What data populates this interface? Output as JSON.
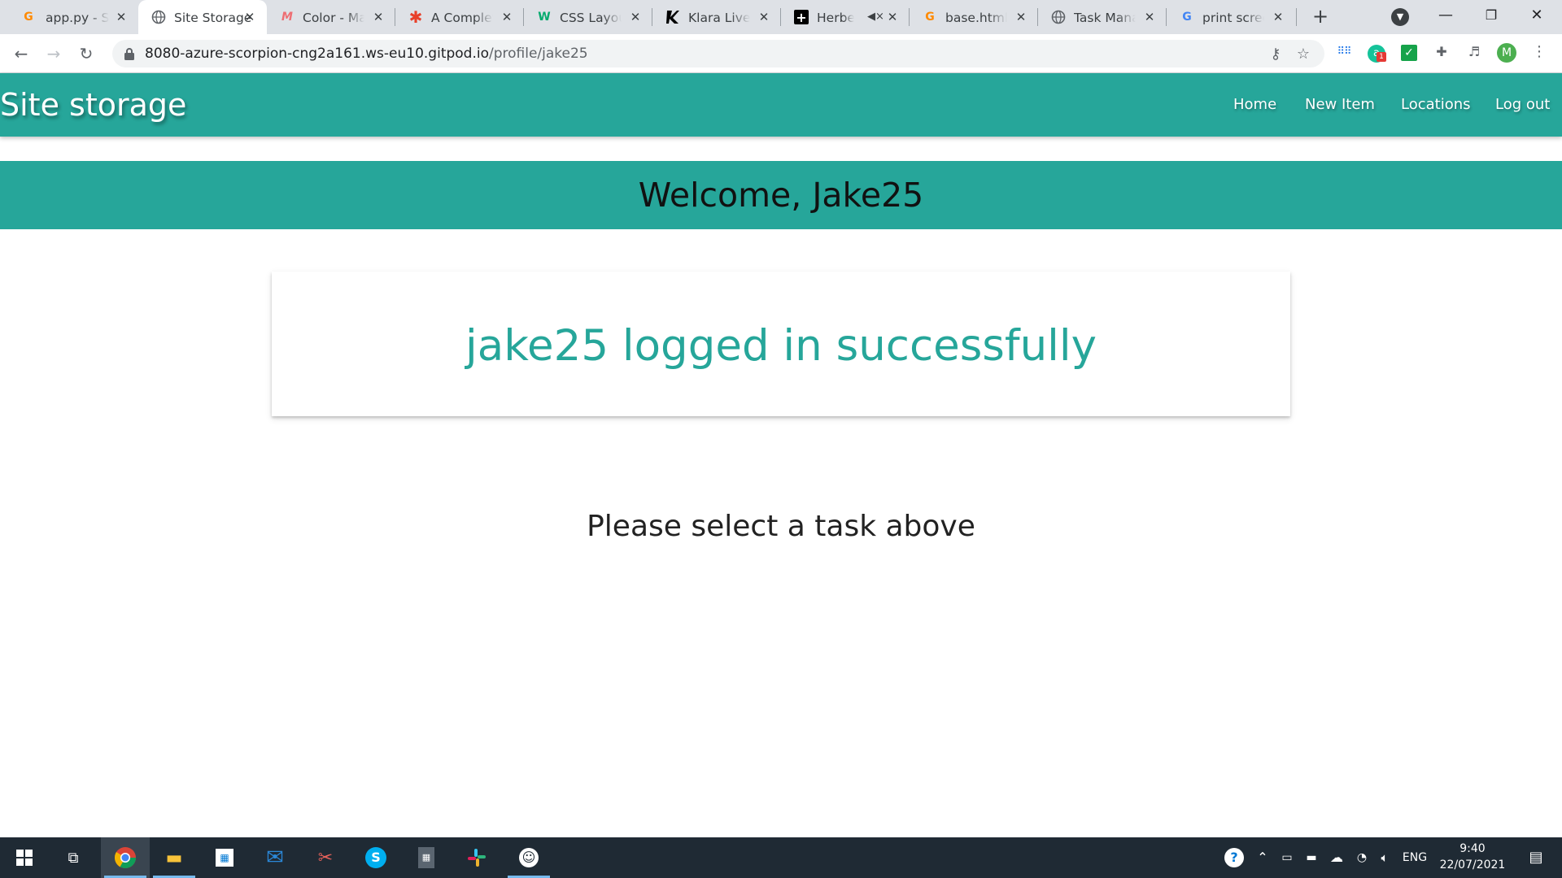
{
  "browser": {
    "tabs": [
      {
        "title": "app.py - Site Storage",
        "favicon": "gitpod-icon",
        "color": "#ff8a00",
        "active": false
      },
      {
        "title": "Site Storage",
        "favicon": "globe-icon",
        "color": "#5f6368",
        "active": true
      },
      {
        "title": "Color - Materialize",
        "favicon": "materialize-icon",
        "color": "#ee6e73",
        "active": false
      },
      {
        "title": "A Complete Guide",
        "favicon": "asterisk-icon",
        "color": "#e8402a",
        "active": false
      },
      {
        "title": "CSS Layout",
        "favicon": "w3schools-icon",
        "color": "#04aa6d",
        "active": false
      },
      {
        "title": "Klara Live | ",
        "favicon": "klara-icon",
        "color": "#000000",
        "active": false
      },
      {
        "title": "Herbelu",
        "favicon": "plus-icon",
        "color": "#000000",
        "active": false,
        "muted": true
      },
      {
        "title": "base.html - ",
        "favicon": "gitpod-icon",
        "color": "#ff8a00",
        "active": false
      },
      {
        "title": "Task Manager",
        "favicon": "globe-icon",
        "color": "#5f6368",
        "active": false
      },
      {
        "title": "print screen",
        "favicon": "google-icon",
        "color": "#4285f4",
        "active": false
      }
    ],
    "url_host": "8080-azure-scorpion-cng2a161.ws-eu10.gitpod.io",
    "url_path": "/profile/jake25",
    "profile_initial": "M",
    "ext_badge": "1"
  },
  "site": {
    "brand": "Site storage",
    "nav": {
      "home": "Home",
      "new_item": "New Item",
      "locations": "Locations",
      "logout": "Log out"
    },
    "welcome": "Welcome, Jake25",
    "flash": "jake25 logged in successfully",
    "prompt": "Please select a task above",
    "accent": "#26a69a"
  },
  "taskbar": {
    "language": "ENG",
    "time": "9:40",
    "date": "22/07/2021"
  }
}
